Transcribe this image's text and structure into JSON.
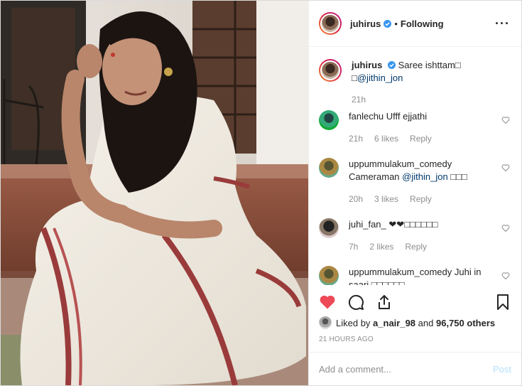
{
  "header": {
    "username": "juhirus",
    "separator": "•",
    "follow_state": "Following",
    "more_icon": "more-horizontal-icon"
  },
  "caption": {
    "username": "juhirus",
    "text": "Saree ishttam",
    "emoji_placeholder_1": "□",
    "emoji_placeholder_2": "□",
    "mention": "@jithin_jon",
    "time": "21h"
  },
  "comments": [
    {
      "username": "fanlechu",
      "text": "Ufff ejjathi",
      "time": "21h",
      "likes": "6 likes",
      "reply": "Reply"
    },
    {
      "username": "uppummulakum_comedy",
      "text_prefix": "Cameraman",
      "mention": "@jithin_jon",
      "text_suffix": "□□□",
      "time": "20h",
      "likes": "3 likes",
      "reply": "Reply"
    },
    {
      "username": "juhi_fan_",
      "text": "❤❤□□□□□□",
      "time": "7h",
      "likes": "2 likes",
      "reply": "Reply"
    },
    {
      "username": "uppummulakum_comedy",
      "text": "Juhi in saari □□□□□□"
    }
  ],
  "actions": {
    "like_icon": "heart-filled-icon",
    "comment_icon": "comment-icon",
    "share_icon": "share-icon",
    "save_icon": "bookmark-icon",
    "like_color": "#ed4956"
  },
  "likes": {
    "prefix": "Liked by",
    "user": "a_nair_98",
    "connector": "and",
    "others": "96,750 others"
  },
  "timestamp": "21 HOURS AGO",
  "add_comment": {
    "placeholder": "Add a comment...",
    "post_label": "Post"
  },
  "colors": {
    "verified": "#3897f0",
    "post_disabled": "#b2dffc",
    "muted": "#8e8e8e"
  }
}
